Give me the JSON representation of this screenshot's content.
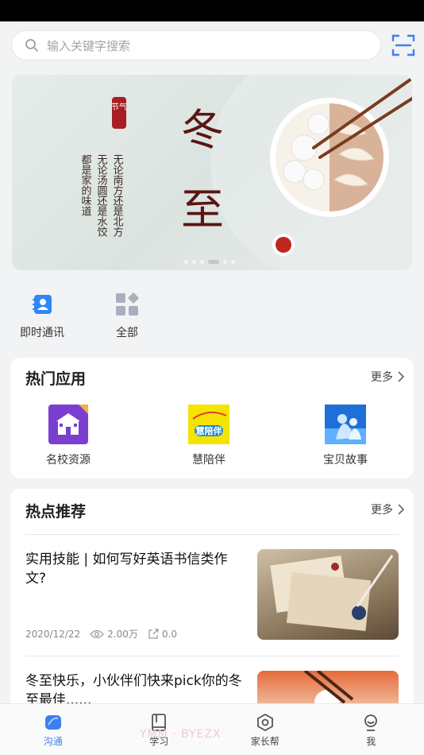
{
  "search": {
    "placeholder": "输入关键字搜索"
  },
  "banner": {
    "title_chars": [
      "冬",
      "至"
    ],
    "seal_text": "节气",
    "poem_col1": "无论南方还是北方",
    "poem_col2": "无论汤圆还是水饺",
    "poem_col3": "都是家的味道",
    "slide_count": 6,
    "active_slide": 4
  },
  "quick": [
    {
      "label": "即时通讯",
      "icon": "contacts-book-icon"
    },
    {
      "label": "全部",
      "icon": "grid-icon"
    }
  ],
  "hot_apps": {
    "title": "热门应用",
    "more": "更多",
    "items": [
      {
        "label": "名校资源",
        "icon": "school-icon",
        "badge_color": "#7a3fd1"
      },
      {
        "label": "慧陪伴",
        "icon": "companion-icon",
        "logo_text": "慧陪伴"
      },
      {
        "label": "宝贝故事",
        "icon": "baby-story-icon"
      }
    ]
  },
  "recommend": {
    "title": "热点推荐",
    "more": "更多",
    "articles": [
      {
        "title": "实用技能 | 如何写好英语书信类作文?",
        "date": "2020/12/22",
        "views": "2.00万",
        "shares": "0.0"
      },
      {
        "title": "冬至快乐，小伙伴们快来pick你的冬至最佳......"
      }
    ]
  },
  "tabs": [
    {
      "label": "沟通",
      "icon": "chat-icon",
      "active": true
    },
    {
      "label": "学习",
      "icon": "book-icon",
      "active": false
    },
    {
      "label": "家长帮",
      "icon": "parent-help-icon",
      "active": false
    },
    {
      "label": "我",
      "icon": "profile-icon",
      "active": false
    }
  ],
  "watermark": "YMM · BYEZX",
  "colors": {
    "accent": "#3d7ff0",
    "banner_red": "#a81d24"
  }
}
